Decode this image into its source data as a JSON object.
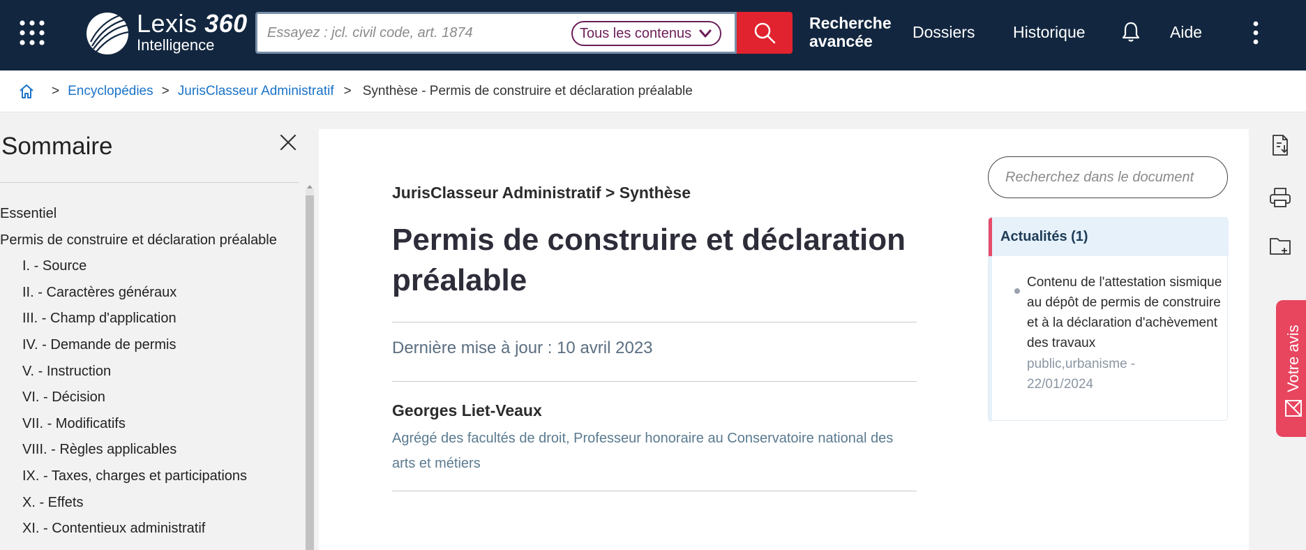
{
  "header": {
    "logo": {
      "brand": "Lexis",
      "brand_num": "360",
      "sub": "Intelligence"
    },
    "search": {
      "placeholder": "Essayez : jcl. civil code, art. 1874",
      "scope": "Tous les contenus"
    },
    "nav": {
      "advanced": "Recherche avancée",
      "dossiers": "Dossiers",
      "historique": "Historique",
      "aide": "Aide"
    },
    "icons": [
      "apps-grid-icon",
      "search-icon",
      "bell-icon",
      "more-vertical-icon"
    ]
  },
  "breadcrumb": {
    "items": [
      "Encyclopédies",
      "JurisClasseur Administratif"
    ],
    "current": "Synthèse - Permis de construire et déclaration préalable"
  },
  "sidebar": {
    "title": "Sommaire",
    "toc": [
      {
        "label": "Essentiel",
        "level": 0
      },
      {
        "label": "Permis de construire et déclaration préalable",
        "level": 0
      },
      {
        "label": "I. - Source",
        "level": 1
      },
      {
        "label": "II. - Caractères généraux",
        "level": 1
      },
      {
        "label": "III. - Champ d'application",
        "level": 1
      },
      {
        "label": "IV. - Demande de permis",
        "level": 1
      },
      {
        "label": "V. - Instruction",
        "level": 1
      },
      {
        "label": "VI. - Décision",
        "level": 1
      },
      {
        "label": "VII. - Modificatifs",
        "level": 1
      },
      {
        "label": "VIII. - Règles applicables",
        "level": 1
      },
      {
        "label": "IX. - Taxes, charges et participations",
        "level": 1
      },
      {
        "label": "X. - Effets",
        "level": 1
      },
      {
        "label": "XI. - Contentieux administratif",
        "level": 1
      }
    ]
  },
  "document": {
    "kicker": "JurisClasseur Administratif > Synthèse",
    "title": "Permis de construire et déclaration préalable",
    "updated": "Dernière mise à jour : 10 avril 2023",
    "author": "Georges Liet-Veaux",
    "author_desc": "Agrégé des facultés de droit, Professeur honoraire au Conservatoire national des arts et métiers",
    "search_placeholder": "Recherchez dans le document"
  },
  "news": {
    "title": "Actualités (1)",
    "items": [
      {
        "text": "Contenu de l'attestation sismique au dépôt de permis de construire et à la déclaration d'achèvement des travaux",
        "meta": "public,urbanisme - 22/01/2024"
      }
    ]
  },
  "feedback": {
    "label": "Votre avis"
  },
  "colors": {
    "header_bg": "#12263f",
    "accent_red": "#e0232e",
    "link_blue": "#1a73c8",
    "scope_purple": "#6b1d58",
    "feedback_pink": "#e8455f"
  }
}
